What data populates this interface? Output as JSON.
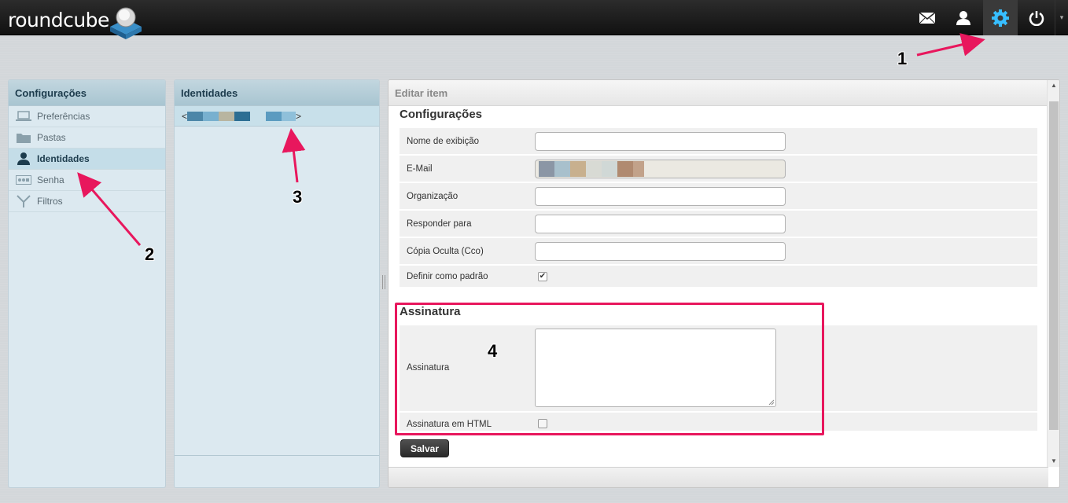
{
  "app": {
    "logo_text": "roundcube"
  },
  "topbar": {
    "icons": [
      "mail-icon",
      "contacts-icon",
      "settings-icon",
      "logout-icon"
    ],
    "active": "settings-icon"
  },
  "settings_panel": {
    "title": "Configurações",
    "items": [
      {
        "label": "Preferências",
        "icon": "laptop-icon"
      },
      {
        "label": "Pastas",
        "icon": "folder-icon"
      },
      {
        "label": "Identidades",
        "icon": "person-icon",
        "selected": true
      },
      {
        "label": "Senha",
        "icon": "password-icon"
      },
      {
        "label": "Filtros",
        "icon": "filter-icon"
      }
    ]
  },
  "identities_panel": {
    "title": "Identidades",
    "identity_prefix": "<",
    "identity_suffix": ">"
  },
  "edit_panel": {
    "title": "Editar item",
    "section_settings": "Configurações",
    "fields": {
      "display_name": "Nome de exibição",
      "email": "E-Mail",
      "organization": "Organização",
      "reply_to": "Responder para",
      "bcc": "Cópia Oculta (Cco)",
      "default": "Definir como padrão"
    },
    "default_checked": true,
    "section_signature": "Assinatura",
    "signature_label": "Assinatura",
    "signature_html_label": "Assinatura em HTML",
    "signature_html_checked": false,
    "save_label": "Salvar"
  },
  "annotations": {
    "n1": "1",
    "n2": "2",
    "n3": "3",
    "n4": "4"
  },
  "colors": {
    "annotation": "#e8175d",
    "accent": "#37beff"
  }
}
